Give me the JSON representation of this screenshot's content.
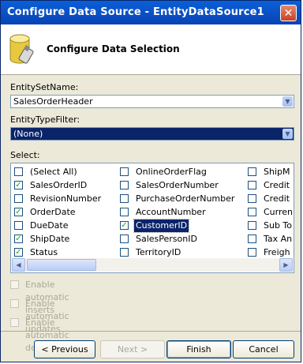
{
  "window": {
    "title": "Configure Data Source - EntityDataSource1",
    "close_glyph": "✕"
  },
  "header": {
    "title": "Configure Data Selection",
    "icon": "database-icon"
  },
  "entity_set": {
    "label": "EntitySetName:",
    "value": "SalesOrderHeader"
  },
  "type_filter": {
    "label": "EntityTypeFilter:",
    "value": "(None)"
  },
  "select": {
    "label": "Select:",
    "columns": [
      [
        {
          "label": "(Select All)",
          "checked": false
        },
        {
          "label": "SalesOrderID",
          "checked": true
        },
        {
          "label": "RevisionNumber",
          "checked": false
        },
        {
          "label": "OrderDate",
          "checked": true
        },
        {
          "label": "DueDate",
          "checked": false
        },
        {
          "label": "ShipDate",
          "checked": true
        },
        {
          "label": "Status",
          "checked": true
        }
      ],
      [
        {
          "label": "OnlineOrderFlag",
          "checked": false
        },
        {
          "label": "SalesOrderNumber",
          "checked": false
        },
        {
          "label": "PurchaseOrderNumber",
          "checked": false
        },
        {
          "label": "AccountNumber",
          "checked": false
        },
        {
          "label": "CustomerID",
          "checked": true,
          "highlighted": true
        },
        {
          "label": "SalesPersonID",
          "checked": false
        },
        {
          "label": "TerritoryID",
          "checked": false
        }
      ],
      [
        {
          "label": "ShipM",
          "checked": false
        },
        {
          "label": "Credit",
          "checked": false
        },
        {
          "label": "Credit",
          "checked": false
        },
        {
          "label": "Curren",
          "checked": false
        },
        {
          "label": "Sub To",
          "checked": false
        },
        {
          "label": "Tax An",
          "checked": false
        },
        {
          "label": "Freigh",
          "checked": false
        }
      ]
    ]
  },
  "options": {
    "inserts": "Enable automatic inserts",
    "updates": "Enable automatic updates",
    "deletes": "Enable automatic deletes"
  },
  "buttons": {
    "previous": "< Previous",
    "next": "Next >",
    "finish": "Finish",
    "cancel": "Cancel"
  },
  "glyphs": {
    "check": "✓",
    "down_arrow": "▼",
    "left_arrow": "◀",
    "right_arrow": "▶"
  }
}
